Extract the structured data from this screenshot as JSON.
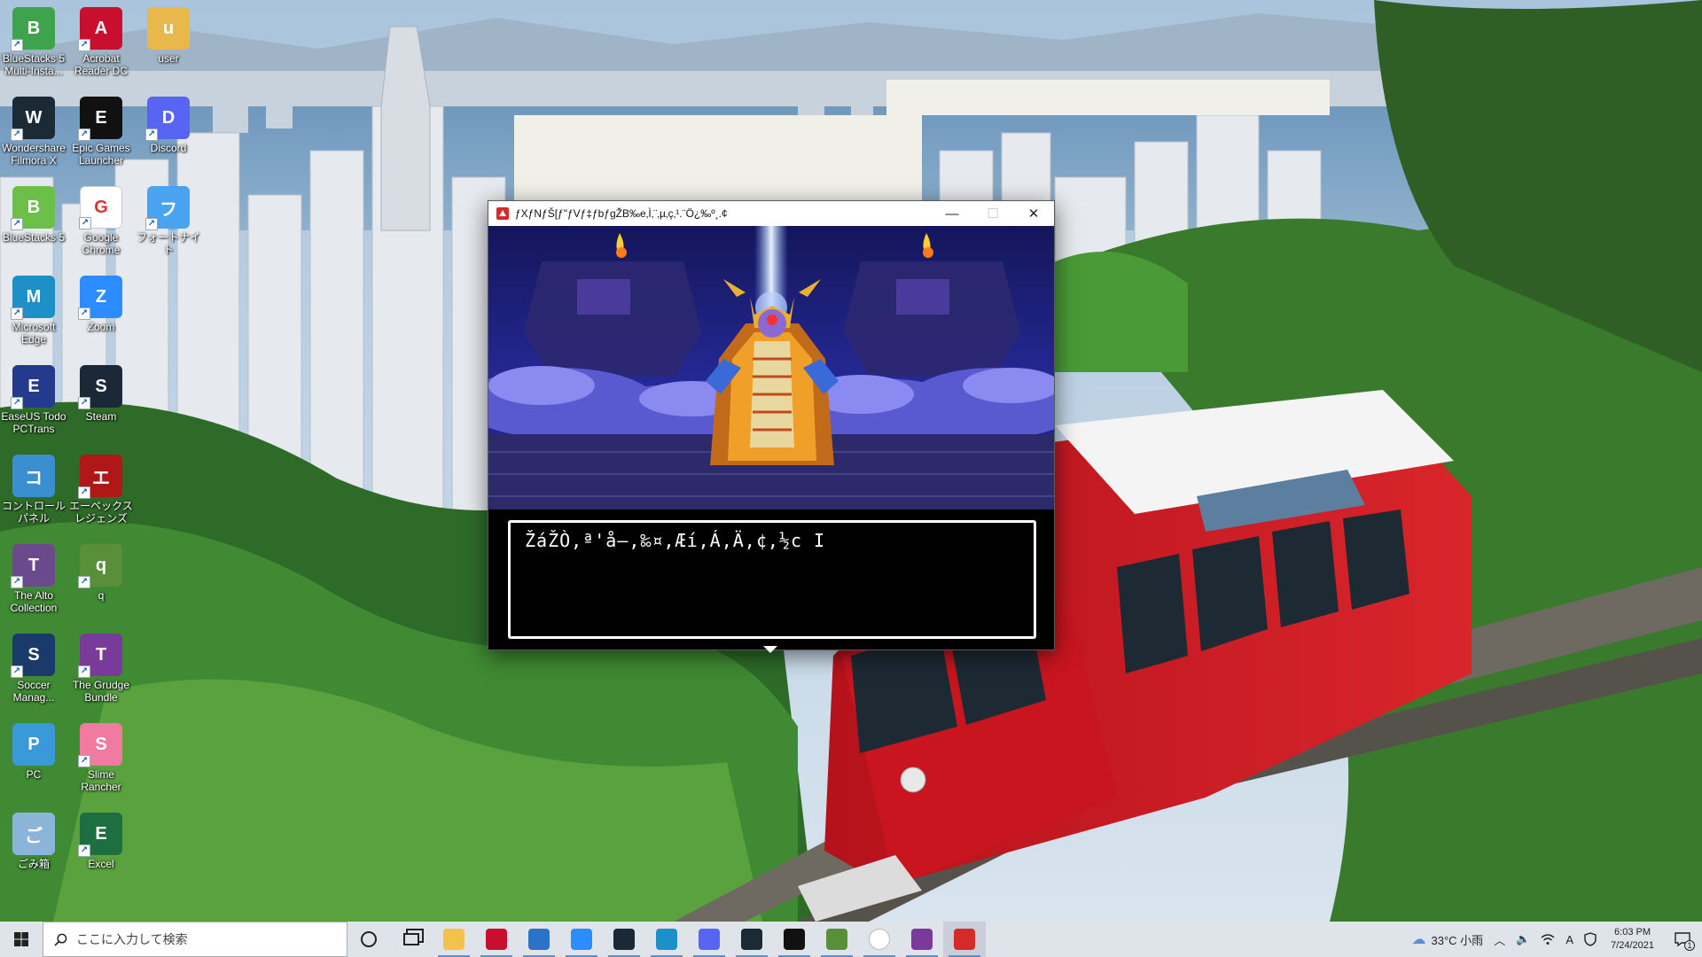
{
  "desktop": {
    "icons": [
      {
        "label": "BlueStacks 5 Multi-Insta...",
        "icon": "bluestacks-multi-icon",
        "color": "#3fa34d"
      },
      {
        "label": "Acrobat Reader DC",
        "icon": "acrobat-icon",
        "color": "#c8102e"
      },
      {
        "label": "user",
        "icon": "user-folder-icon",
        "color": "#e8b84a"
      },
      {
        "label": "Wondershare Filmora X",
        "icon": "filmora-icon",
        "color": "#1c2a36"
      },
      {
        "label": "Epic Games Launcher",
        "icon": "epic-games-icon",
        "color": "#111111"
      },
      {
        "label": "Discord",
        "icon": "discord-icon",
        "color": "#5865f2"
      },
      {
        "label": "BlueStacks 5",
        "icon": "bluestacks-icon",
        "color": "#6cc04a"
      },
      {
        "label": "Google Chrome",
        "icon": "chrome-icon",
        "color": "#ffffff"
      },
      {
        "label": "フォートナイト",
        "icon": "fortnite-icon",
        "color": "#4aa3f0"
      },
      {
        "label": "Microsoft Edge",
        "icon": "edge-icon",
        "color": "#1e90c8"
      },
      {
        "label": "Zoom",
        "icon": "zoom-icon",
        "color": "#2d8cff"
      },
      {
        "label": "EaseUS Todo PCTrans",
        "icon": "easeus-icon",
        "color": "#243a8c"
      },
      {
        "label": "Steam",
        "icon": "steam-icon",
        "color": "#1b2838"
      },
      {
        "label": "コントロール パネル",
        "icon": "control-panel-icon",
        "color": "#3a8fd0"
      },
      {
        "label": "エーペックスレジェンズ",
        "icon": "apex-icon",
        "color": "#b01818"
      },
      {
        "label": "The Alto Collection",
        "icon": "alto-icon",
        "color": "#6a4a8a"
      },
      {
        "label": "q",
        "icon": "minecraft-icon",
        "color": "#5a8f3a"
      },
      {
        "label": "Soccer Manag...",
        "icon": "soccer-manager-icon",
        "color": "#1a3a6a"
      },
      {
        "label": "The Grudge Bundle",
        "icon": "winrar-icon",
        "color": "#7a3a9a"
      },
      {
        "label": "PC",
        "icon": "pc-icon",
        "color": "#3a9ad9"
      },
      {
        "label": "Slime Rancher",
        "icon": "slime-rancher-icon",
        "color": "#f07aa0"
      },
      {
        "label": "ごみ箱",
        "icon": "recycle-bin-icon",
        "color": "#8ab4d8"
      },
      {
        "label": "Excel",
        "icon": "excel-icon",
        "color": "#1d6f42"
      }
    ]
  },
  "window": {
    "title": "ƒXƒNƒŠ[ƒ\"ƒVƒ‡ƒbƒgŽB‰e‚Ì‚¨‚µ‚ç‚¹.¨Ö¿‰º¸.¢",
    "minimize": "—",
    "maximize": "☐",
    "close": "✕"
  },
  "dialog": {
    "text": "ŽáŽÒ‚ª'å–‚‰¤‚Æí‚Á‚Ä‚¢‚½c I"
  },
  "taskbar": {
    "search_placeholder": "ここに入力して検索",
    "apps": [
      {
        "name": "cortana",
        "icon": "cortana-icon"
      },
      {
        "name": "task-view",
        "icon": "task-view-icon"
      },
      {
        "name": "file-explorer",
        "icon": "folder-icon",
        "color": "#f2c24a"
      },
      {
        "name": "acrobat",
        "icon": "acrobat-icon",
        "color": "#c8102e"
      },
      {
        "name": "mail",
        "icon": "mail-icon",
        "color": "#2a73c8"
      },
      {
        "name": "zoom",
        "icon": "zoom-icon",
        "color": "#2d8cff"
      },
      {
        "name": "steam",
        "icon": "steam-icon",
        "color": "#1b2838"
      },
      {
        "name": "edge",
        "icon": "edge-icon",
        "color": "#1e90c8"
      },
      {
        "name": "discord",
        "icon": "discord-icon",
        "color": "#5865f2"
      },
      {
        "name": "filmora",
        "icon": "filmora-icon",
        "color": "#1c2a36"
      },
      {
        "name": "epic-games",
        "icon": "epic-games-icon",
        "color": "#111111"
      },
      {
        "name": "minecraft",
        "icon": "minecraft-icon",
        "color": "#5a8f3a"
      },
      {
        "name": "chrome",
        "icon": "chrome-icon",
        "color": "#ffffff"
      },
      {
        "name": "winrar",
        "icon": "winrar-icon",
        "color": "#7a3a9a"
      },
      {
        "name": "game",
        "icon": "game-app-icon",
        "color": "#d42a2a"
      }
    ],
    "weather": "33°C 小雨",
    "ime": "A",
    "time": "6:03 PM",
    "date": "7/24/2021",
    "notifications": "1"
  }
}
